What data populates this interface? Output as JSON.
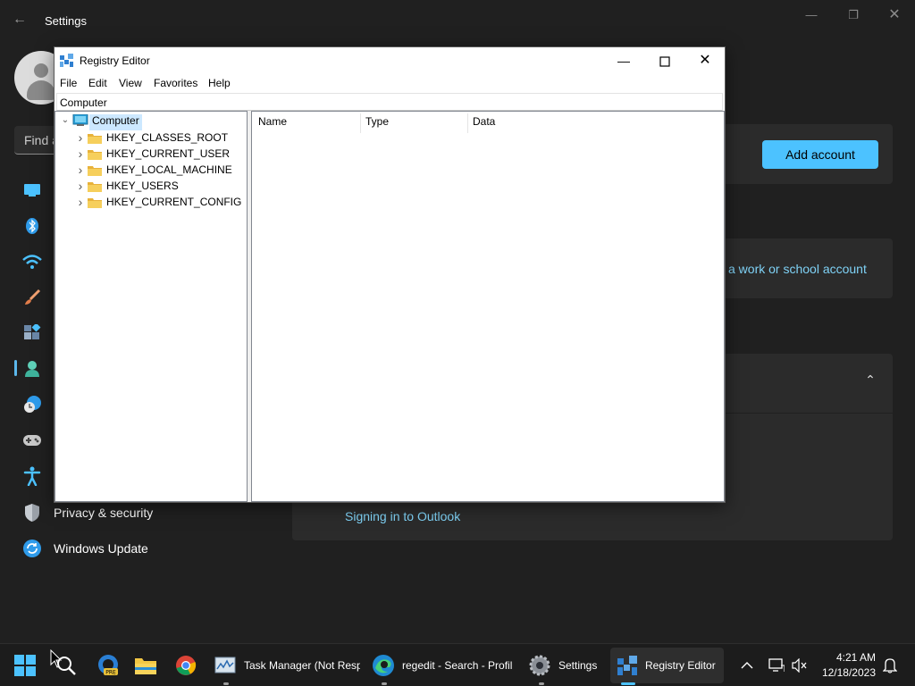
{
  "settings": {
    "title": "Settings",
    "search_placeholder": "Find a",
    "nav": [
      {
        "icon": "system-icon"
      },
      {
        "icon": "bluetooth-icon"
      },
      {
        "icon": "wifi-icon"
      },
      {
        "icon": "personalization-brush-icon"
      },
      {
        "icon": "apps-icon"
      },
      {
        "icon": "accounts-person-icon",
        "active": true
      },
      {
        "icon": "time-language-icon"
      },
      {
        "icon": "gaming-controller-icon"
      },
      {
        "icon": "accessibility-icon"
      },
      {
        "icon": "privacy-shield-icon",
        "label": "Privacy & security"
      },
      {
        "icon": "windows-update-icon",
        "label": "Windows Update"
      }
    ],
    "add_account_label": "Add account",
    "work_school_link": "a work or school account",
    "outlook_link": "Signing in to Outlook",
    "accent_color": "#4cc2ff"
  },
  "regedit": {
    "title": "Registry Editor",
    "menu": [
      "File",
      "Edit",
      "View",
      "Favorites",
      "Help"
    ],
    "address": "Computer",
    "tree_root": "Computer",
    "hives": [
      "HKEY_CLASSES_ROOT",
      "HKEY_CURRENT_USER",
      "HKEY_LOCAL_MACHINE",
      "HKEY_USERS",
      "HKEY_CURRENT_CONFIG"
    ],
    "columns": [
      "Name",
      "Type",
      "Data"
    ]
  },
  "taskbar": {
    "apps": [
      {
        "name": "Task Manager (Not Resp"
      },
      {
        "name": "regedit - Search - Profil"
      },
      {
        "name": "Settings"
      },
      {
        "name": "Registry Editor"
      }
    ],
    "time": "4:21 AM",
    "date": "12/18/2023"
  }
}
